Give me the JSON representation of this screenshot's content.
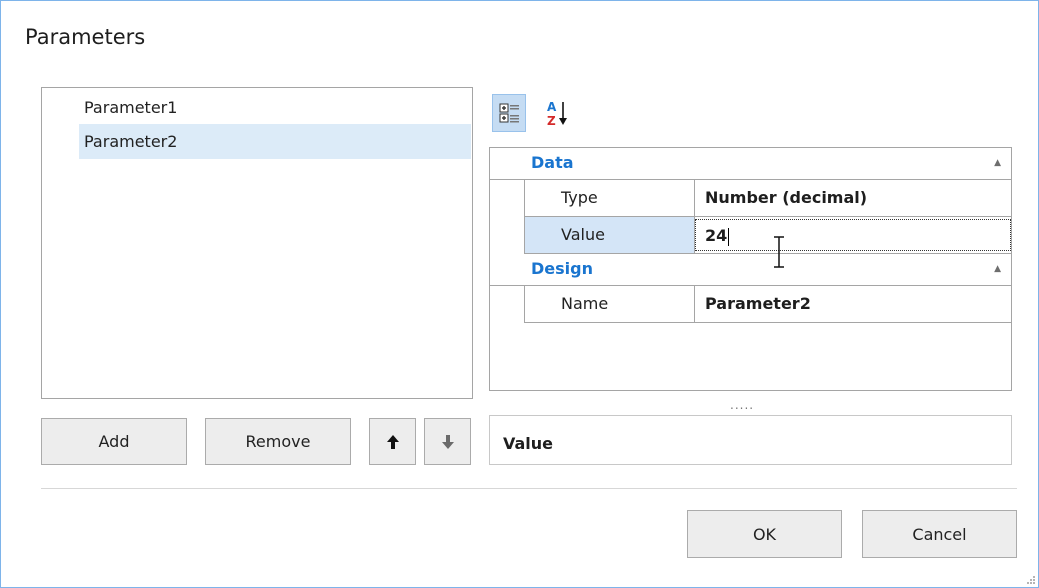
{
  "dialog": {
    "title": "Parameters"
  },
  "parameters": {
    "items": [
      {
        "label": "Parameter1"
      },
      {
        "label": "Parameter2"
      }
    ],
    "selected_label": "Parameter2"
  },
  "list_buttons": {
    "add_label": "Add",
    "remove_label": "Remove",
    "move_up_glyph": "🡅",
    "move_down_glyph": "🡇"
  },
  "toolbar": {
    "categorized_icon": "categorized-view-icon",
    "alphabetical_icon": "alphabetical-sort-icon",
    "alpha_a": "A",
    "alpha_z": "Z"
  },
  "property_grid": {
    "categories": [
      {
        "label": "Data",
        "properties": [
          {
            "name": "Type",
            "value": "Number (decimal)"
          },
          {
            "name": "Value",
            "value": "24"
          }
        ]
      },
      {
        "label": "Design",
        "properties": [
          {
            "name": "Name",
            "value": "Parameter2"
          }
        ]
      }
    ],
    "collapse_glyph": "▲",
    "splitter_dots": "....."
  },
  "description": {
    "title": "Value"
  },
  "footer": {
    "ok_label": "OK",
    "cancel_label": "Cancel"
  },
  "colors": {
    "accent": "#1a75cf",
    "selection": "#dcebf8",
    "window_border": "#7eb4ea",
    "button_face": "#ededed"
  }
}
